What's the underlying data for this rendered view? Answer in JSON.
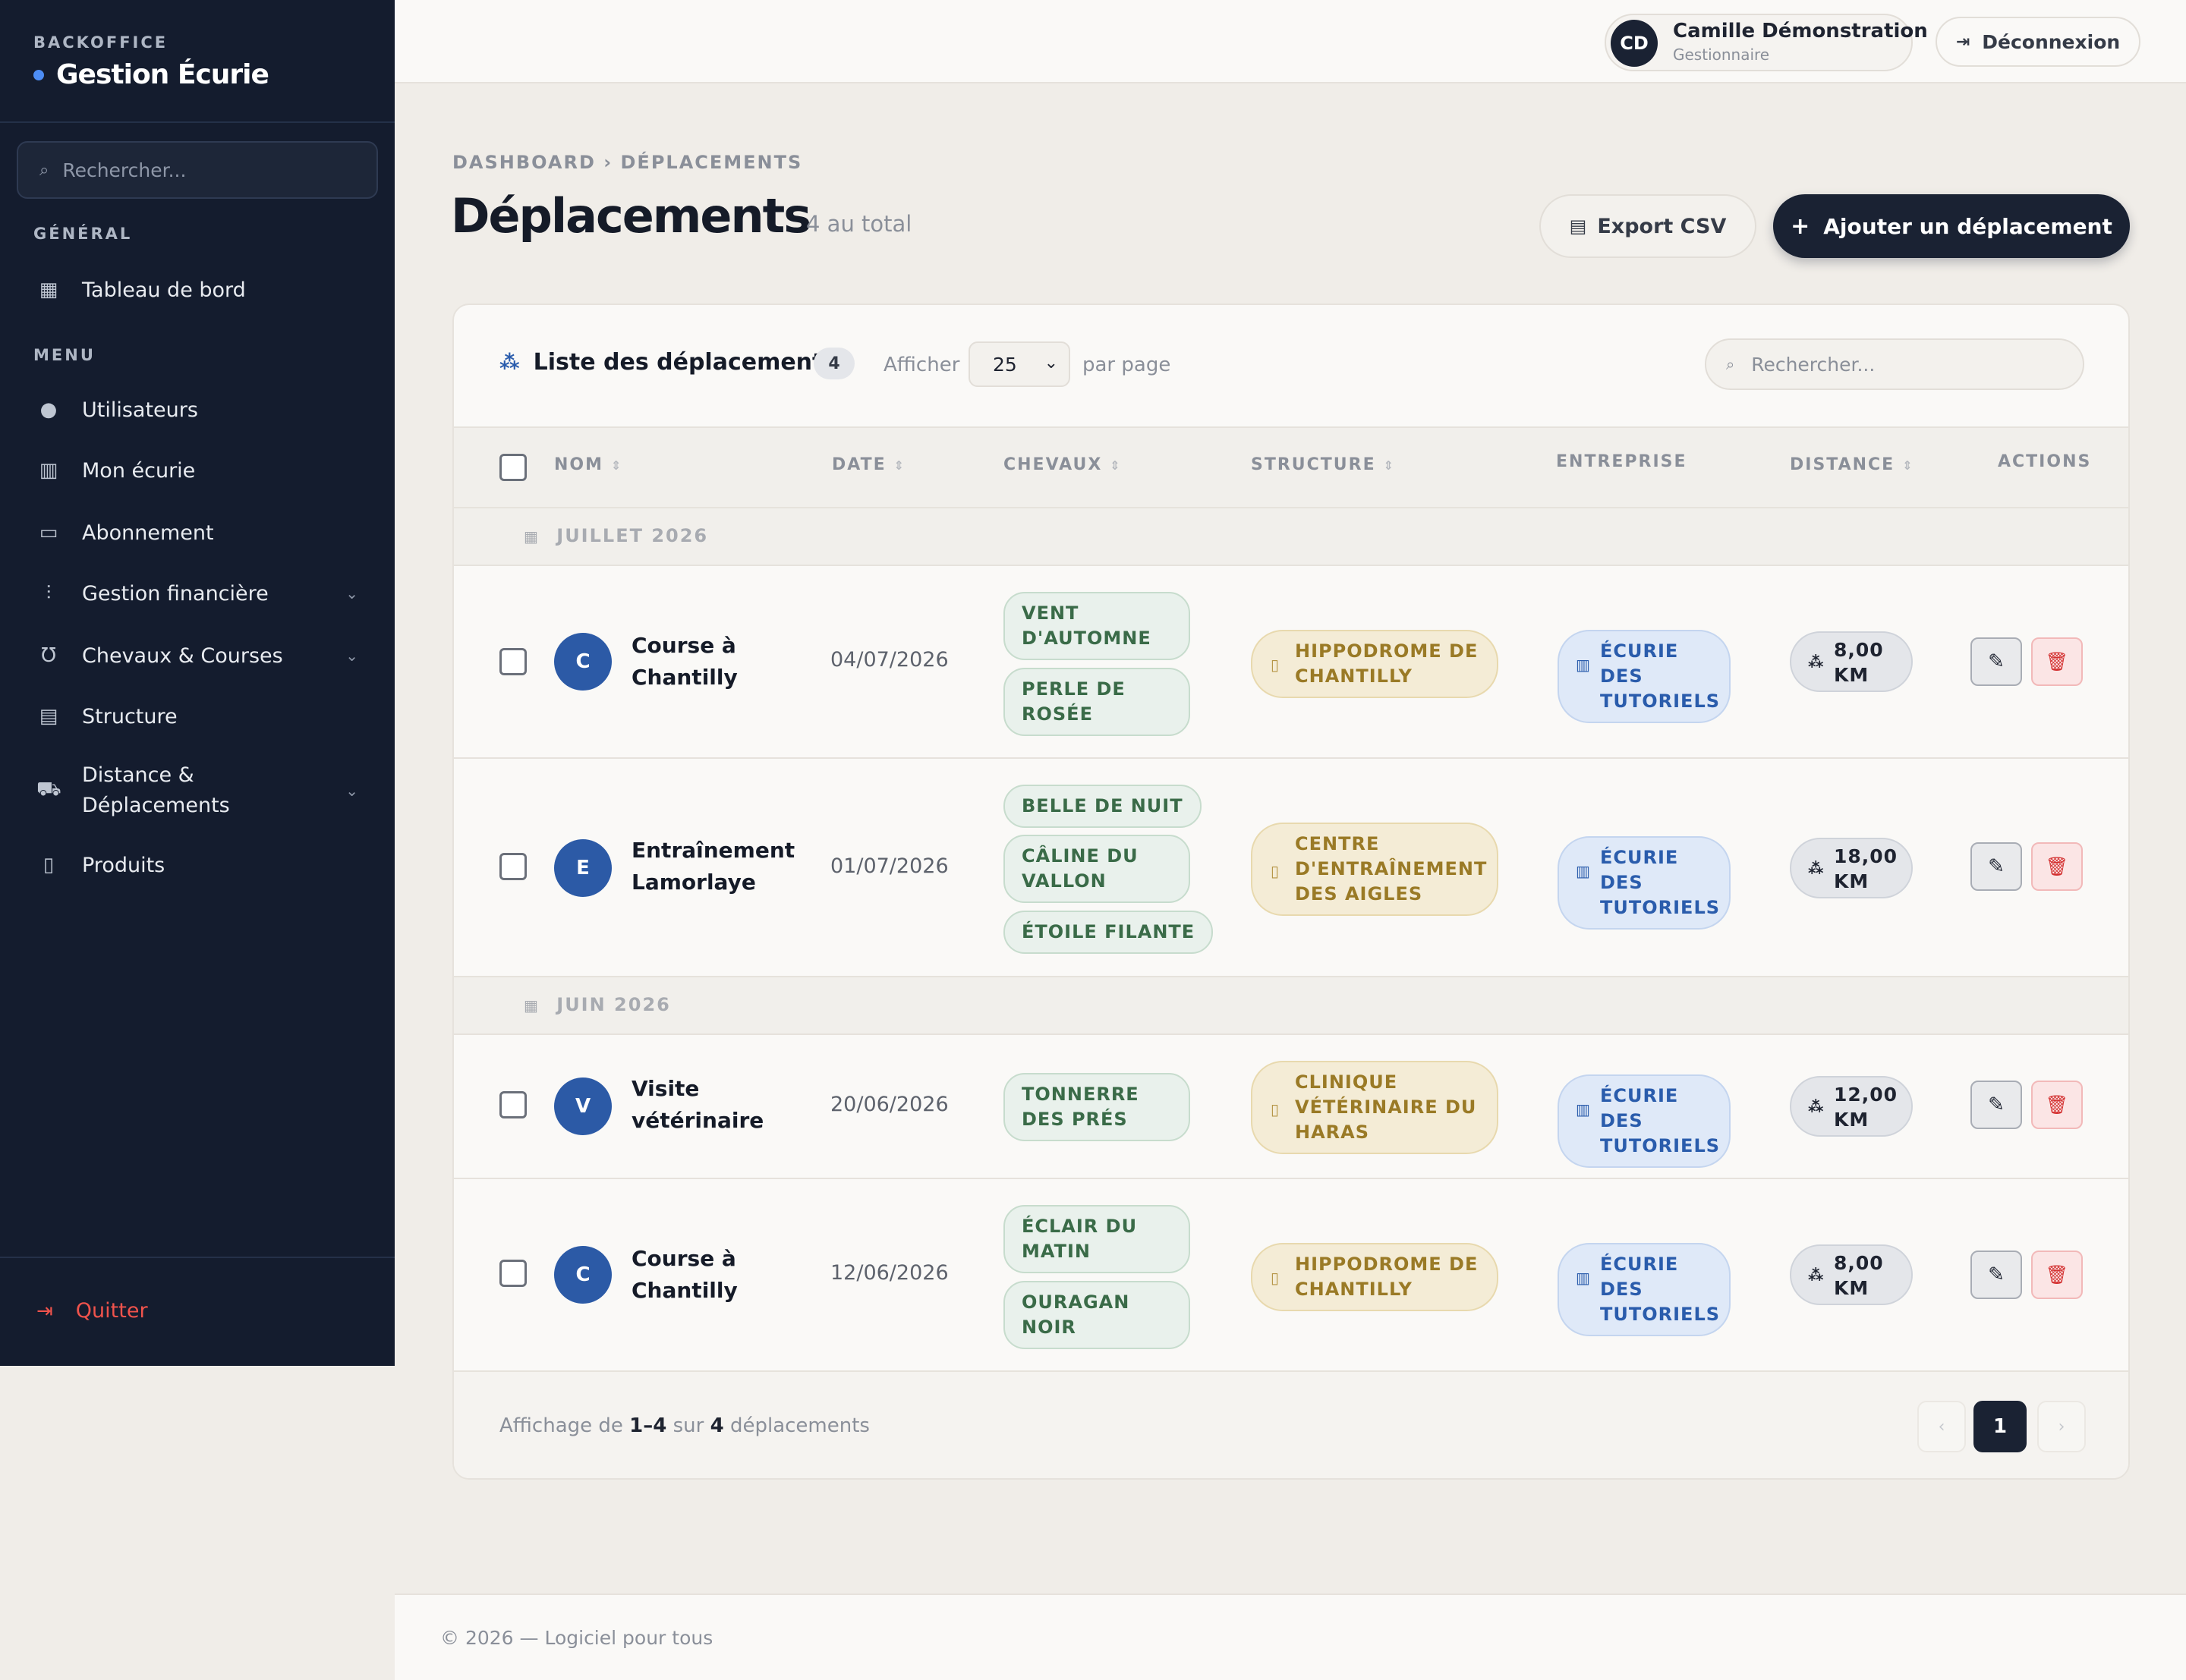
{
  "sidebar": {
    "kicker": "BACKOFFICE",
    "title": "Gestion Écurie",
    "search_placeholder": "Rechercher...",
    "section_general": "GÉNÉRAL",
    "section_menu": "MENU",
    "items": [
      {
        "label": "Tableau de bord",
        "icon": "dashboard-icon"
      },
      {
        "label": "Utilisateurs",
        "icon": "user-circle-icon"
      },
      {
        "label": "Mon écurie",
        "icon": "building-icon"
      },
      {
        "label": "Abonnement",
        "icon": "credit-card-icon"
      },
      {
        "label": "Gestion financière",
        "icon": "finance-icon",
        "expandable": true
      },
      {
        "label": "Chevaux & Courses",
        "icon": "horseshoe-icon",
        "expandable": true
      },
      {
        "label": "Structure",
        "icon": "structure-icon"
      },
      {
        "label": "Distance & Déplacements",
        "icon": "car-icon",
        "expandable": true
      },
      {
        "label": "Produits",
        "icon": "barcode-icon"
      }
    ],
    "quit_label": "Quitter"
  },
  "topbar": {
    "user_initials": "CD",
    "user_name": "Camille Démonstration",
    "user_role": "Gestionnaire",
    "logout_label": "Déconnexion"
  },
  "header": {
    "breadcrumb": "DASHBOARD › DÉPLACEMENTS",
    "title": "Déplacements",
    "count_label": "4 au total",
    "export_label": "Export CSV",
    "add_label": "Ajouter un déplacement"
  },
  "table": {
    "title": "Liste des déplacements",
    "count": "4",
    "show_label": "Afficher",
    "per_page_value": "25",
    "per_page_label": "par page",
    "search_placeholder": "Rechercher...",
    "columns": {
      "nom": "NOM",
      "date": "DATE",
      "chevaux": "CHEVAUX",
      "structure": "STRUCTURE",
      "entreprise": "ENTREPRISE",
      "distance": "DISTANCE",
      "actions": "ACTIONS"
    },
    "groups": [
      {
        "label": "JUILLET 2026",
        "rows": [
          {
            "initial": "C",
            "name": "Course à Chantilly",
            "date": "04/07/2026",
            "horses": [
              "VENT D'AUTOMNE",
              "PERLE DE ROSÉE"
            ],
            "structure": "HIPPODROME DE CHANTILLY",
            "company": "ÉCURIE DES TUTORIELS",
            "distance": "8,00 KM"
          },
          {
            "initial": "E",
            "name": "Entraînement Lamorlaye",
            "date": "01/07/2026",
            "horses": [
              "BELLE DE NUIT",
              "CÂLINE DU VALLON",
              "ÉTOILE FILANTE"
            ],
            "structure": "CENTRE D'ENTRAÎNEMENT DES AIGLES",
            "company": "ÉCURIE DES TUTORIELS",
            "distance": "18,00 KM"
          }
        ]
      },
      {
        "label": "JUIN 2026",
        "rows": [
          {
            "initial": "V",
            "name": "Visite vétérinaire",
            "date": "20/06/2026",
            "horses": [
              "TONNERRE DES PRÉS"
            ],
            "structure": "CLINIQUE VÉTÉRINAIRE DU HARAS",
            "company": "ÉCURIE DES TUTORIELS",
            "distance": "12,00 KM"
          },
          {
            "initial": "C",
            "name": "Course à Chantilly",
            "date": "12/06/2026",
            "horses": [
              "ÉCLAIR DU MATIN",
              "OURAGAN NOIR"
            ],
            "structure": "HIPPODROME DE CHANTILLY",
            "company": "ÉCURIE DES TUTORIELS",
            "distance": "8,00 KM"
          }
        ]
      }
    ],
    "footer": {
      "prefix": "Affichage de",
      "range": "1–4",
      "middle": "sur",
      "total": "4",
      "suffix": "déplacements"
    },
    "current_page": "1"
  },
  "footer": {
    "text": "© 2026 — Logiciel pour tous"
  },
  "colors": {
    "sidebar_bg": "#141c2e",
    "accent_dark": "#1a2233",
    "avatar_blue": "#2c5aa6",
    "horse_tag": "#3a6b48",
    "structure_tag": "#9a7a26",
    "company_tag": "#2a5cac",
    "danger": "#d32f2f"
  }
}
